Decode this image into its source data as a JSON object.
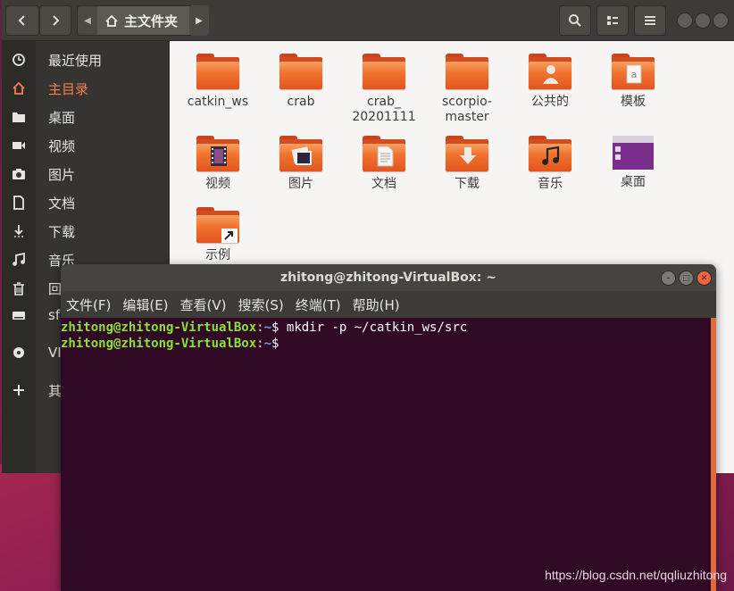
{
  "colors": {
    "accent": "#f37f4e",
    "terminal_bg": "#300a24",
    "prompt_user": "#8ae234",
    "prompt_path": "#729fcf"
  },
  "files_window": {
    "pathbar": {
      "current": "主文件夹",
      "icon": "home-icon"
    },
    "sidebar": {
      "items": [
        {
          "label": "最近使用",
          "icon": "clock-icon"
        },
        {
          "label": "主目录",
          "icon": "home-icon",
          "active": true
        },
        {
          "label": "桌面",
          "icon": "folder-icon"
        },
        {
          "label": "视频",
          "icon": "video-icon"
        },
        {
          "label": "图片",
          "icon": "camera-icon"
        },
        {
          "label": "文档",
          "icon": "document-icon"
        },
        {
          "label": "下载",
          "icon": "download-icon"
        },
        {
          "label": "音乐",
          "icon": "music-icon"
        },
        {
          "label": "回",
          "icon": "trash-icon"
        },
        {
          "label": "sf",
          "icon": "drive-icon"
        },
        {
          "label": "VI",
          "icon": "disc-icon"
        },
        {
          "label": "其",
          "icon": "plus-icon"
        }
      ]
    },
    "items": [
      {
        "label": "catkin_ws",
        "emblem": ""
      },
      {
        "label": "crab",
        "emblem": ""
      },
      {
        "label": "crab_\n20201111",
        "emblem": ""
      },
      {
        "label": "scorpio-\nmaster",
        "emblem": ""
      },
      {
        "label": "公共的",
        "emblem": "person"
      },
      {
        "label": "模板",
        "emblem": "template"
      },
      {
        "label": "视频",
        "emblem": "film"
      },
      {
        "label": "图片",
        "emblem": "photo"
      },
      {
        "label": "文档",
        "emblem": "doc"
      },
      {
        "label": "下载",
        "emblem": "download"
      },
      {
        "label": "音乐",
        "emblem": "music"
      },
      {
        "label": "桌面",
        "emblem": "desktop"
      },
      {
        "label": "示例",
        "emblem": "link"
      }
    ]
  },
  "terminal": {
    "title": "zhitong@zhitong-VirtualBox: ~",
    "menu": [
      "文件(F)",
      "编辑(E)",
      "查看(V)",
      "搜索(S)",
      "终端(T)",
      "帮助(H)"
    ],
    "lines": [
      {
        "user": "zhitong@zhitong-VirtualBox",
        "path": "~",
        "cmd": " mkdir -p ~/catkin_ws/src"
      },
      {
        "user": "zhitong@zhitong-VirtualBox",
        "path": "~",
        "cmd": " "
      }
    ]
  },
  "watermark": "https://blog.csdn.net/qqliuzhitong"
}
